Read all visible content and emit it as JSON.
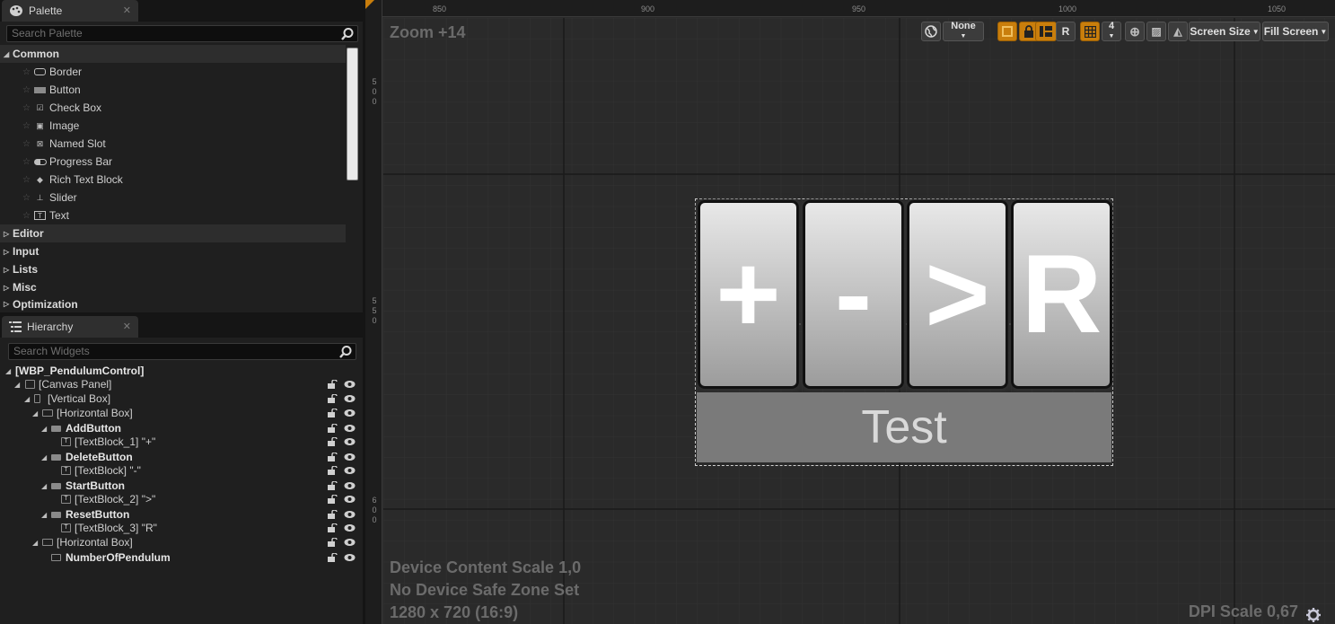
{
  "palette": {
    "tab_title": "Palette",
    "search_placeholder": "Search Palette",
    "categories": {
      "common": "Common",
      "editor": "Editor",
      "input": "Input",
      "lists": "Lists",
      "misc": "Misc",
      "optimization": "Optimization"
    },
    "items": [
      "Border",
      "Button",
      "Check Box",
      "Image",
      "Named Slot",
      "Progress Bar",
      "Rich Text Block",
      "Slider",
      "Text"
    ]
  },
  "hierarchy": {
    "tab_title": "Hierarchy",
    "search_placeholder": "Search Widgets",
    "rows": [
      "[WBP_PendulumControl]",
      "[Canvas Panel]",
      "[Vertical Box]",
      "[Horizontal Box]",
      "AddButton",
      "[TextBlock_1] \"+\"",
      "DeleteButton",
      "[TextBlock] \"-\"",
      "StartButton",
      "[TextBlock_2] \">\"",
      "ResetButton",
      "[TextBlock_3] \"R\"",
      "[Horizontal Box]",
      "NumberOfPendulum"
    ]
  },
  "viewport": {
    "zoom": "Zoom +14",
    "ruler_top": [
      "850",
      "900",
      "950",
      "1000",
      "1050"
    ],
    "ruler_left": [
      "500",
      "550",
      "600"
    ],
    "toolbar": {
      "localize": "None",
      "r_button": "R",
      "grid_snap": "4",
      "screen_size": "Screen Size",
      "fill_screen": "Fill Screen"
    },
    "buttons": [
      "+",
      "-",
      ">",
      "R"
    ],
    "test_text": "Test",
    "info_scale": "Device Content Scale 1,0",
    "info_safezone": "No Device Safe Zone Set",
    "info_resolution": "1280 x 720 (16:9)",
    "dpi_scale": "DPI Scale 0,67"
  }
}
